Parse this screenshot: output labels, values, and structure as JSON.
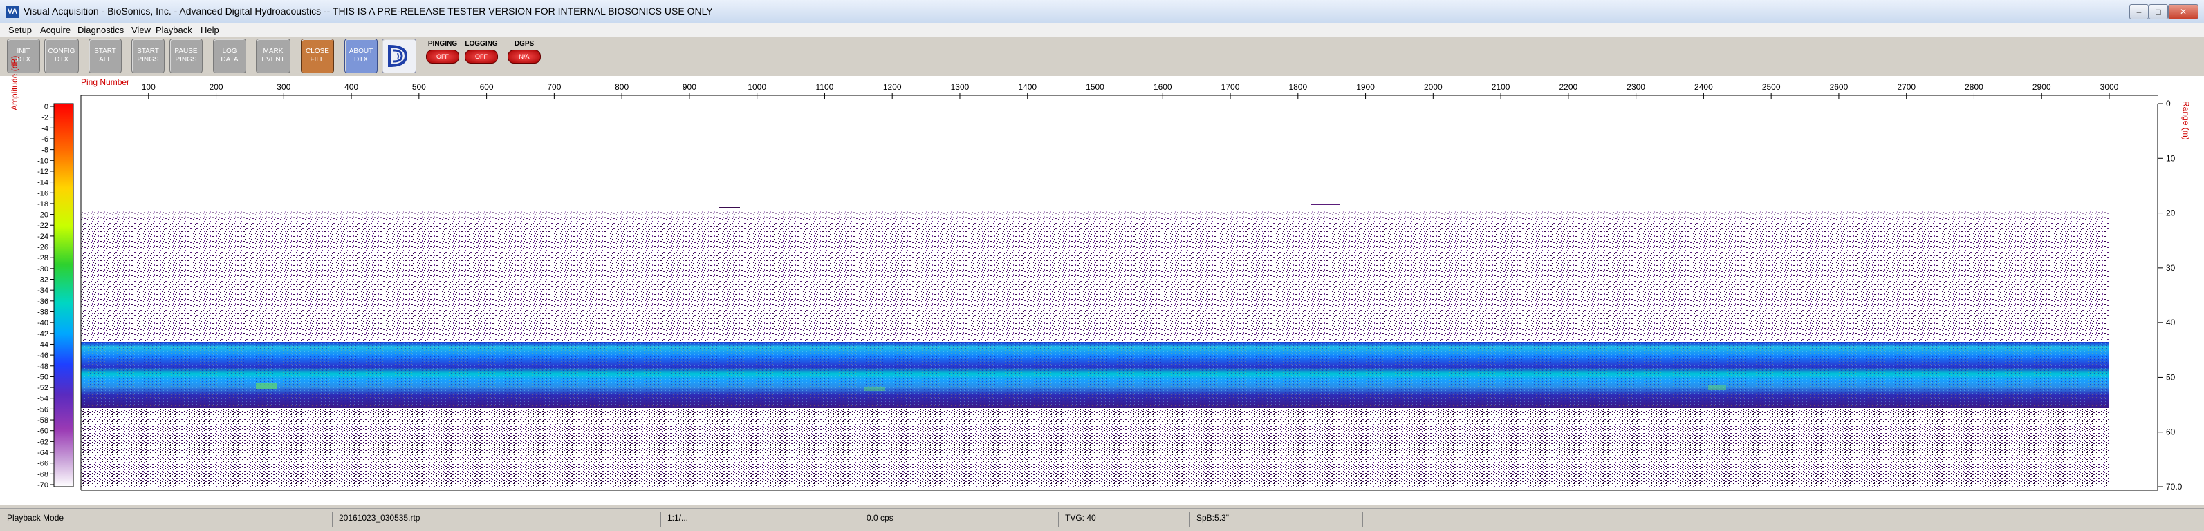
{
  "window": {
    "title": "Visual Acquisition  -  BioSonics, Inc.  -  Advanced Digital Hydroacoustics  -- THIS IS A PRE-RELEASE TESTER VERSION FOR INTERNAL BIOSONICS USE ONLY",
    "icon_text": "VA"
  },
  "menu": [
    "Setup",
    "Acquire",
    "Diagnostics",
    "View",
    "Playback",
    "Help"
  ],
  "toolbar": {
    "buttons": [
      {
        "label": "INIT\nDTX",
        "style": "gray"
      },
      {
        "label": "CONFIG\nDTX",
        "style": "gray"
      },
      {
        "label": "START\nALL",
        "style": "gray"
      },
      {
        "label": "START\nPINGS",
        "style": "gray"
      },
      {
        "label": "PAUSE\nPINGS",
        "style": "gray"
      },
      {
        "label": "LOG\nDATA",
        "style": "gray"
      },
      {
        "label": "MARK\nEVENT",
        "style": "gray"
      },
      {
        "label": "CLOSE\nFILE",
        "style": "orange"
      },
      {
        "label": "ABOUT\nDTX",
        "style": "blue"
      }
    ],
    "lamps": [
      {
        "label": "PINGING",
        "state": "OFF"
      },
      {
        "label": "LOGGING",
        "state": "OFF"
      },
      {
        "label": "DGPS",
        "state": "N/A"
      }
    ]
  },
  "plot": {
    "ping_axis_label": "Ping Number",
    "ping_ticks": [
      "100",
      "200",
      "300",
      "400",
      "500",
      "600",
      "700",
      "800",
      "900",
      "1000",
      "1100",
      "1200",
      "1300",
      "1400",
      "1500",
      "1600",
      "1700",
      "1800",
      "1900",
      "2000",
      "2100",
      "2200",
      "2300",
      "2400",
      "2500",
      "2600",
      "2700",
      "2800",
      "2900",
      "3000"
    ],
    "amplitude_label": "Amplitude (dB)",
    "amplitude_ticks": [
      "0",
      "-2",
      "-4",
      "-6",
      "-8",
      "-10",
      "-12",
      "-14",
      "-16",
      "-18",
      "-20",
      "-22",
      "-24",
      "-26",
      "-28",
      "-30",
      "-32",
      "-34",
      "-36",
      "-38",
      "-40",
      "-42",
      "-44",
      "-46",
      "-48",
      "-50",
      "-52",
      "-54",
      "-56",
      "-58",
      "-60",
      "-62",
      "-64",
      "-66",
      "-68",
      "-70"
    ],
    "range_label": "Range (m)",
    "range_ticks": [
      "0",
      "10",
      "20",
      "30",
      "40",
      "50",
      "60",
      "70.0"
    ],
    "colors": {
      "axis_label": "#d00000"
    }
  },
  "status": {
    "mode": "Playback Mode",
    "file": "20161023_030535.rtp",
    "ratio": "1:1/...",
    "rate": "0.0 cps",
    "tvg": "TVG: 40",
    "spb": "SpB:5.3\""
  }
}
